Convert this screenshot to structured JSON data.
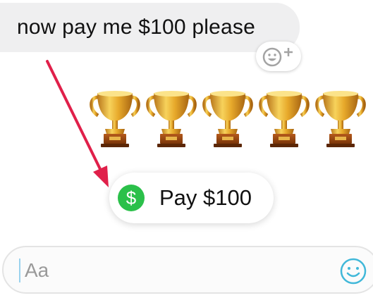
{
  "message": {
    "text": "now pay me $100 please"
  },
  "reaction": {
    "icon": "add-reaction-icon"
  },
  "trophies": {
    "icon": "trophy-icon",
    "count": 5
  },
  "payment": {
    "label": "Pay $100",
    "icon": "dollar-icon",
    "icon_color": "#2bc04a"
  },
  "composer": {
    "placeholder": "Aa",
    "emoji_icon": "smiley-icon",
    "accent": "#41b8d9"
  },
  "annotation": {
    "icon": "red-arrow-icon",
    "color": "#e0204a"
  }
}
